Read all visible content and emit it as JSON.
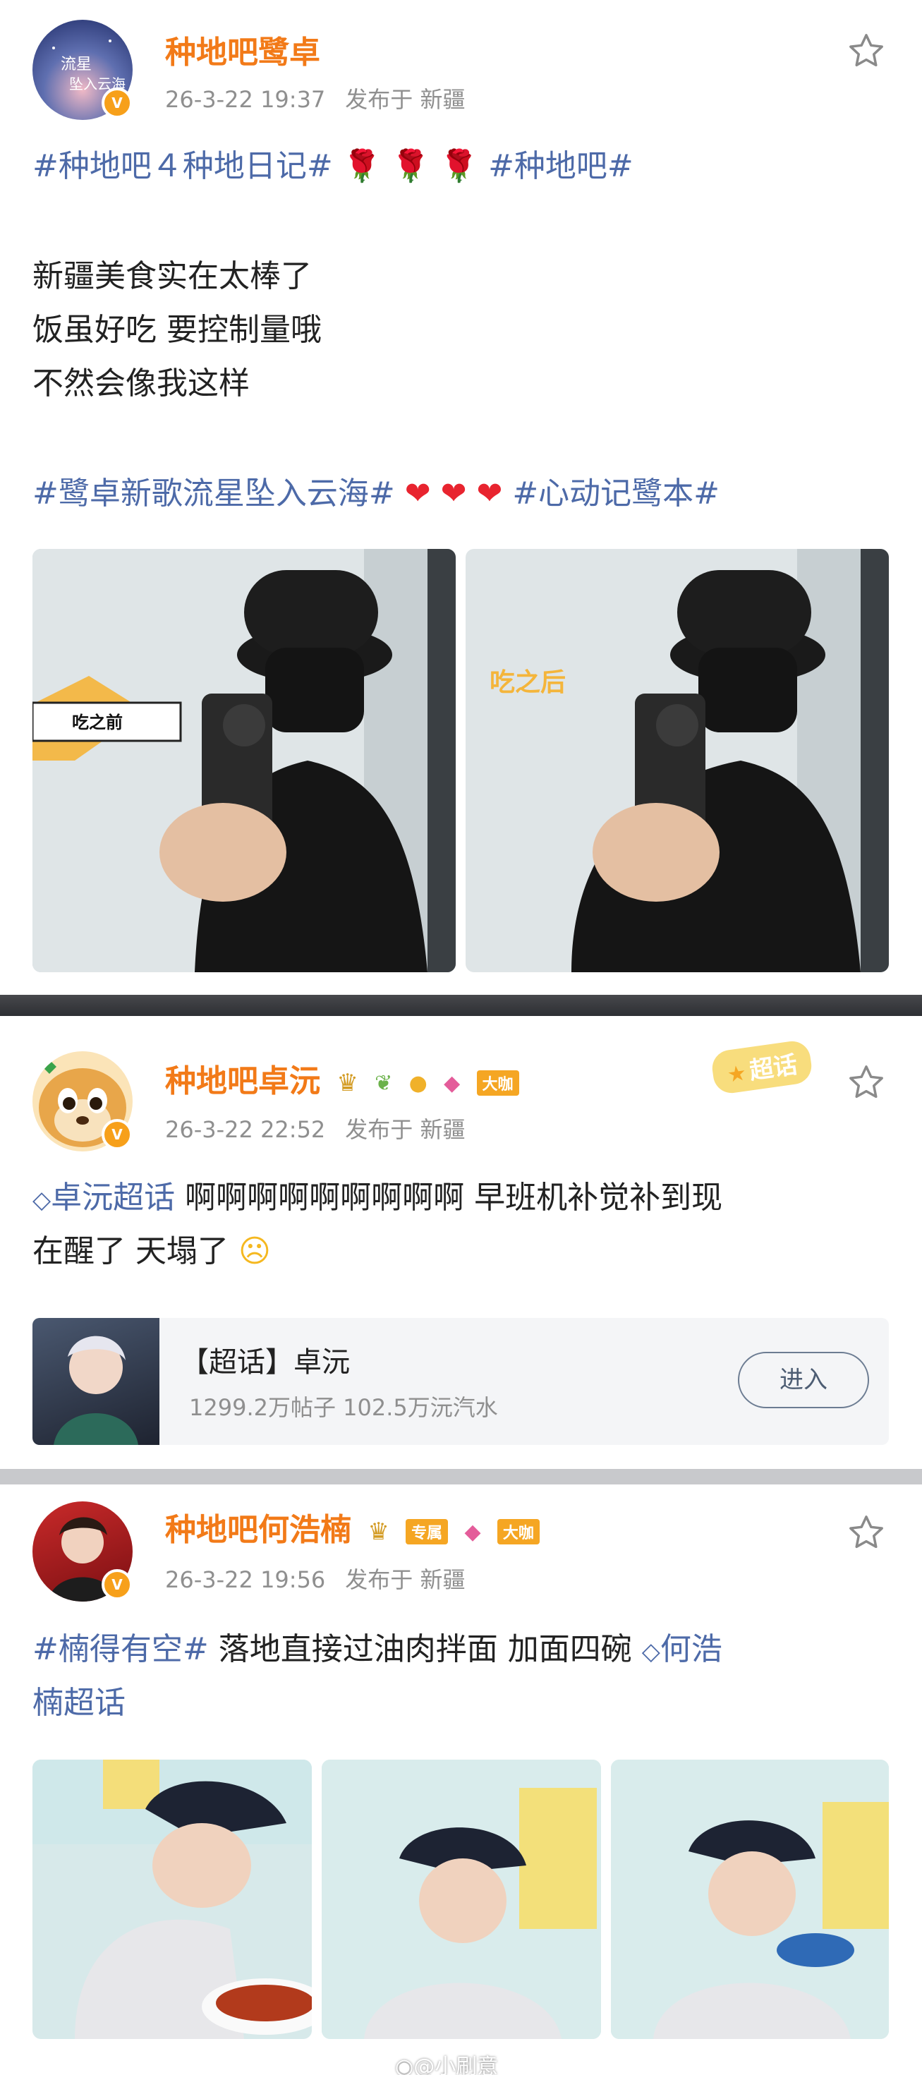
{
  "posts": [
    {
      "author": "种地吧鹭卓",
      "time": "26-3-22 19:37",
      "location": "发布于 新疆",
      "tag1": "#种地吧４种地日记#",
      "roses": "🌹 🌹 🌹",
      "tag2": "#种地吧#",
      "line1": "新疆美食实在太棒了",
      "line2": "饭虽好吃 要控制量哦",
      "line3": "不然会像我这样",
      "tag3": "#鹭卓新歌流星坠入云海#",
      "hearts": "❤ ❤ ❤",
      "tag4": "#心动记鹭本#",
      "img1_caption": "吃之前",
      "img2_caption": "吃之后"
    },
    {
      "author": "种地吧卓沅",
      "badge": "大咖",
      "time": "26-3-22 22:52",
      "location": "发布于 新疆",
      "sticker": "超话",
      "topic": "卓沅超话",
      "line1": " 啊啊啊啊啊啊啊啊啊 早班机补觉补到现",
      "line2": "在醒了 天塌了",
      "card_title": "【超话】卓沅",
      "card_stats": "1299.2万帖子 102.5万沅汽水",
      "card_button": "进入"
    },
    {
      "author": "种地吧何浩楠",
      "badge1": "专属",
      "badge2": "大咖",
      "time": "26-3-22 19:56",
      "location": "发布于 新疆",
      "tag1": "#楠得有空#",
      "line1": " 落地直接过油肉拌面  加面四碗",
      "topic_a": "何浩",
      "topic_b": "楠超话"
    }
  ],
  "watermark": "@小刷意"
}
